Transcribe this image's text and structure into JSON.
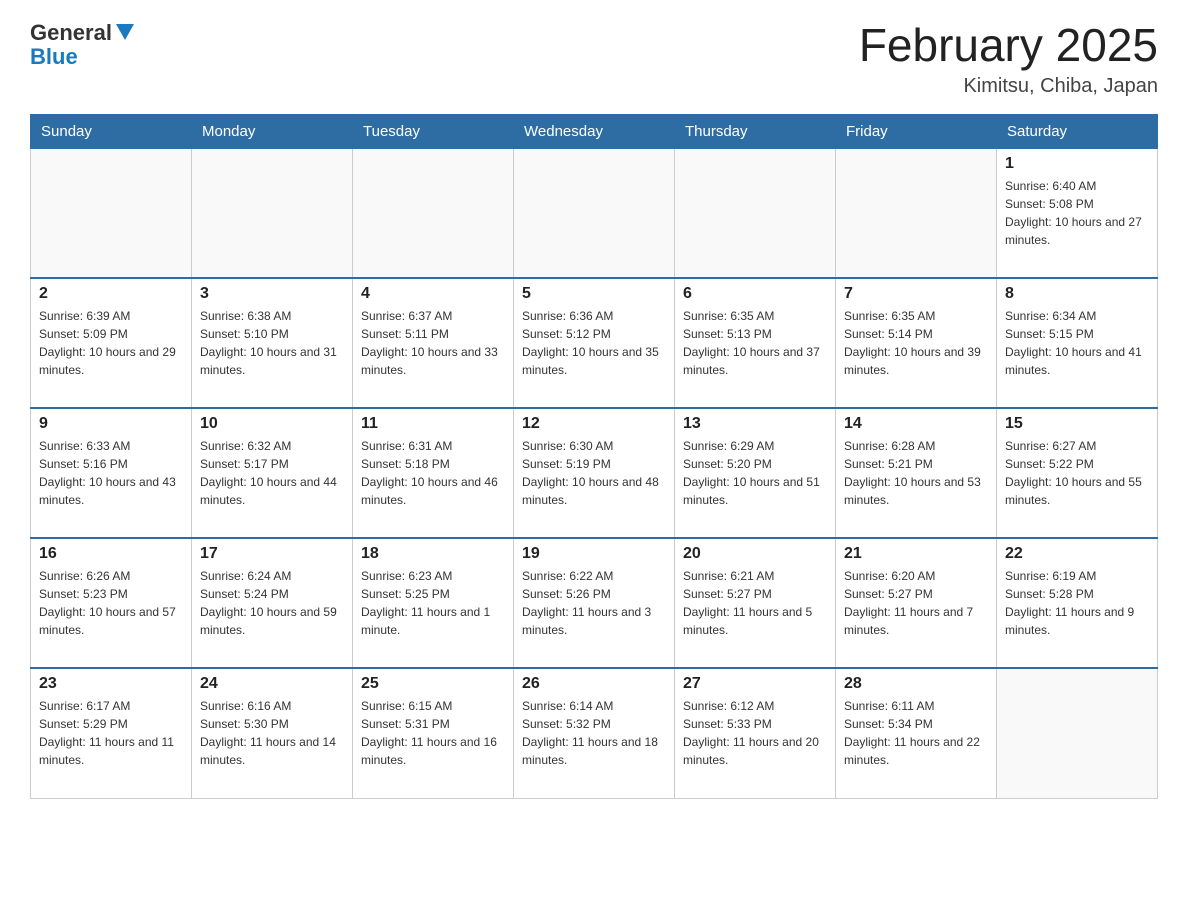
{
  "header": {
    "logo": {
      "general": "General",
      "blue": "Blue"
    },
    "title": "February 2025",
    "location": "Kimitsu, Chiba, Japan"
  },
  "weekdays": [
    "Sunday",
    "Monday",
    "Tuesday",
    "Wednesday",
    "Thursday",
    "Friday",
    "Saturday"
  ],
  "weeks": [
    [
      {
        "day": "",
        "info": ""
      },
      {
        "day": "",
        "info": ""
      },
      {
        "day": "",
        "info": ""
      },
      {
        "day": "",
        "info": ""
      },
      {
        "day": "",
        "info": ""
      },
      {
        "day": "",
        "info": ""
      },
      {
        "day": "1",
        "info": "Sunrise: 6:40 AM\nSunset: 5:08 PM\nDaylight: 10 hours and 27 minutes."
      }
    ],
    [
      {
        "day": "2",
        "info": "Sunrise: 6:39 AM\nSunset: 5:09 PM\nDaylight: 10 hours and 29 minutes."
      },
      {
        "day": "3",
        "info": "Sunrise: 6:38 AM\nSunset: 5:10 PM\nDaylight: 10 hours and 31 minutes."
      },
      {
        "day": "4",
        "info": "Sunrise: 6:37 AM\nSunset: 5:11 PM\nDaylight: 10 hours and 33 minutes."
      },
      {
        "day": "5",
        "info": "Sunrise: 6:36 AM\nSunset: 5:12 PM\nDaylight: 10 hours and 35 minutes."
      },
      {
        "day": "6",
        "info": "Sunrise: 6:35 AM\nSunset: 5:13 PM\nDaylight: 10 hours and 37 minutes."
      },
      {
        "day": "7",
        "info": "Sunrise: 6:35 AM\nSunset: 5:14 PM\nDaylight: 10 hours and 39 minutes."
      },
      {
        "day": "8",
        "info": "Sunrise: 6:34 AM\nSunset: 5:15 PM\nDaylight: 10 hours and 41 minutes."
      }
    ],
    [
      {
        "day": "9",
        "info": "Sunrise: 6:33 AM\nSunset: 5:16 PM\nDaylight: 10 hours and 43 minutes."
      },
      {
        "day": "10",
        "info": "Sunrise: 6:32 AM\nSunset: 5:17 PM\nDaylight: 10 hours and 44 minutes."
      },
      {
        "day": "11",
        "info": "Sunrise: 6:31 AM\nSunset: 5:18 PM\nDaylight: 10 hours and 46 minutes."
      },
      {
        "day": "12",
        "info": "Sunrise: 6:30 AM\nSunset: 5:19 PM\nDaylight: 10 hours and 48 minutes."
      },
      {
        "day": "13",
        "info": "Sunrise: 6:29 AM\nSunset: 5:20 PM\nDaylight: 10 hours and 51 minutes."
      },
      {
        "day": "14",
        "info": "Sunrise: 6:28 AM\nSunset: 5:21 PM\nDaylight: 10 hours and 53 minutes."
      },
      {
        "day": "15",
        "info": "Sunrise: 6:27 AM\nSunset: 5:22 PM\nDaylight: 10 hours and 55 minutes."
      }
    ],
    [
      {
        "day": "16",
        "info": "Sunrise: 6:26 AM\nSunset: 5:23 PM\nDaylight: 10 hours and 57 minutes."
      },
      {
        "day": "17",
        "info": "Sunrise: 6:24 AM\nSunset: 5:24 PM\nDaylight: 10 hours and 59 minutes."
      },
      {
        "day": "18",
        "info": "Sunrise: 6:23 AM\nSunset: 5:25 PM\nDaylight: 11 hours and 1 minute."
      },
      {
        "day": "19",
        "info": "Sunrise: 6:22 AM\nSunset: 5:26 PM\nDaylight: 11 hours and 3 minutes."
      },
      {
        "day": "20",
        "info": "Sunrise: 6:21 AM\nSunset: 5:27 PM\nDaylight: 11 hours and 5 minutes."
      },
      {
        "day": "21",
        "info": "Sunrise: 6:20 AM\nSunset: 5:27 PM\nDaylight: 11 hours and 7 minutes."
      },
      {
        "day": "22",
        "info": "Sunrise: 6:19 AM\nSunset: 5:28 PM\nDaylight: 11 hours and 9 minutes."
      }
    ],
    [
      {
        "day": "23",
        "info": "Sunrise: 6:17 AM\nSunset: 5:29 PM\nDaylight: 11 hours and 11 minutes."
      },
      {
        "day": "24",
        "info": "Sunrise: 6:16 AM\nSunset: 5:30 PM\nDaylight: 11 hours and 14 minutes."
      },
      {
        "day": "25",
        "info": "Sunrise: 6:15 AM\nSunset: 5:31 PM\nDaylight: 11 hours and 16 minutes."
      },
      {
        "day": "26",
        "info": "Sunrise: 6:14 AM\nSunset: 5:32 PM\nDaylight: 11 hours and 18 minutes."
      },
      {
        "day": "27",
        "info": "Sunrise: 6:12 AM\nSunset: 5:33 PM\nDaylight: 11 hours and 20 minutes."
      },
      {
        "day": "28",
        "info": "Sunrise: 6:11 AM\nSunset: 5:34 PM\nDaylight: 11 hours and 22 minutes."
      },
      {
        "day": "",
        "info": ""
      }
    ]
  ]
}
